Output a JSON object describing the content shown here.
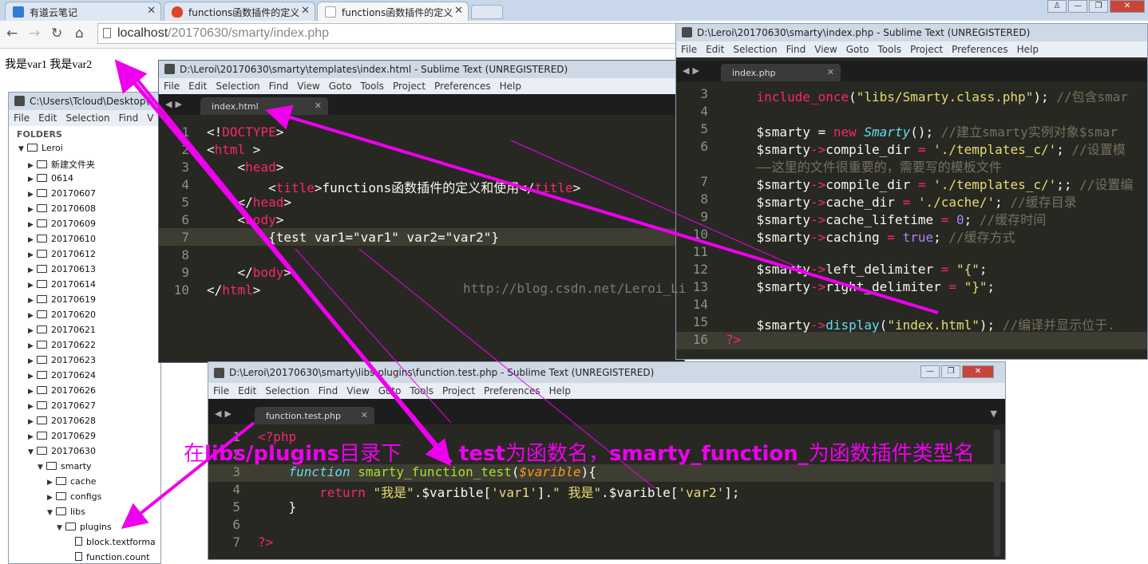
{
  "browser": {
    "tabs": [
      {
        "label": "有道云笔记",
        "icon_color": "#2f7bd8"
      },
      {
        "label": "functions函数插件的定义",
        "icon_color": "#e0442a"
      },
      {
        "label": "functions函数插件的定义",
        "icon_color": "#9aa7b8"
      }
    ],
    "url_host": "localhost",
    "url_path": "/20170630/smarty/index.php",
    "page_output": "我是var1 我是var2"
  },
  "menu_items": [
    "File",
    "Edit",
    "Selection",
    "Find",
    "View",
    "Goto",
    "Tools",
    "Project",
    "Preferences",
    "Help"
  ],
  "folders_window": {
    "title": "C:\\Users\\Tcloud\\Desktop\\2",
    "menu": [
      "File",
      "Edit",
      "Selection",
      "Find",
      "V"
    ],
    "header": "FOLDERS",
    "tree": [
      {
        "label": "Leroi",
        "depth": 0,
        "type": "open"
      },
      {
        "label": "新建文件夹",
        "depth": 1,
        "type": "closed"
      },
      {
        "label": "0614",
        "depth": 1,
        "type": "closed"
      },
      {
        "label": "20170607",
        "depth": 1,
        "type": "closed"
      },
      {
        "label": "20170608",
        "depth": 1,
        "type": "closed"
      },
      {
        "label": "20170609",
        "depth": 1,
        "type": "closed"
      },
      {
        "label": "20170610",
        "depth": 1,
        "type": "closed"
      },
      {
        "label": "20170612",
        "depth": 1,
        "type": "closed"
      },
      {
        "label": "20170613",
        "depth": 1,
        "type": "closed"
      },
      {
        "label": "20170614",
        "depth": 1,
        "type": "closed"
      },
      {
        "label": "20170619",
        "depth": 1,
        "type": "closed"
      },
      {
        "label": "20170620",
        "depth": 1,
        "type": "closed"
      },
      {
        "label": "20170621",
        "depth": 1,
        "type": "closed"
      },
      {
        "label": "20170622",
        "depth": 1,
        "type": "closed"
      },
      {
        "label": "20170623",
        "depth": 1,
        "type": "closed"
      },
      {
        "label": "20170624",
        "depth": 1,
        "type": "closed"
      },
      {
        "label": "20170626",
        "depth": 1,
        "type": "closed"
      },
      {
        "label": "20170627",
        "depth": 1,
        "type": "closed"
      },
      {
        "label": "20170628",
        "depth": 1,
        "type": "closed"
      },
      {
        "label": "20170629",
        "depth": 1,
        "type": "closed"
      },
      {
        "label": "20170630",
        "depth": 1,
        "type": "open"
      },
      {
        "label": "smarty",
        "depth": 2,
        "type": "open"
      },
      {
        "label": "cache",
        "depth": 3,
        "type": "closed"
      },
      {
        "label": "configs",
        "depth": 3,
        "type": "closed"
      },
      {
        "label": "libs",
        "depth": 3,
        "type": "open"
      },
      {
        "label": "plugins",
        "depth": 4,
        "type": "open"
      },
      {
        "label": "block.textforma",
        "depth": 5,
        "type": "file"
      },
      {
        "label": "function.count",
        "depth": 5,
        "type": "file"
      }
    ]
  },
  "index_html_window": {
    "title": "D:\\Leroi\\20170630\\smarty\\templates\\index.html - Sublime Text (UNREGISTERED)",
    "tab": "index.html",
    "line_numbers": [
      "1",
      "2",
      "3",
      "4",
      "5",
      "6",
      "7",
      "8",
      "9",
      "10"
    ],
    "title_text": "functions函数插件的定义和使用",
    "test_call": "{test var1=\"var1\" var2=\"var2\"}"
  },
  "index_php_window": {
    "title": "D:\\Leroi\\20170630\\smarty\\index.php - Sublime Text (UNREGISTERED)",
    "tab": "index.php",
    "line_numbers": [
      "3",
      "4",
      "5",
      "6",
      "",
      "7",
      "8",
      "9",
      "10",
      "11",
      "12",
      "13",
      "14",
      "15",
      "16"
    ],
    "comments": {
      "l3": "//包含smar",
      "l5": "//建立smarty实例对象$smar",
      "l6": "//设置模",
      "l6b": "——这里的文件很重要的，需要写的模板文件",
      "l7": "//设置编",
      "l8": "//缓存目录",
      "l9": "//缓存时间",
      "l10": "//缓存方式",
      "l15": "//编译并显示位于."
    }
  },
  "function_test_window": {
    "title": "D:\\Leroi\\20170630\\smarty\\libs\\plugins\\function.test.php - Sublime Text (UNREGISTERED)",
    "tab": "function.test.php",
    "line_numbers": [
      "1",
      "2",
      "3",
      "4",
      "5",
      "6",
      "7"
    ]
  },
  "annotations": {
    "plugins_dir_prefix": "在",
    "plugins_dir_path": "libs/plugins",
    "plugins_dir_suffix": "目录下",
    "func_name_1": "test",
    "func_name_2": "为函数名，",
    "func_name_3": "smarty_function_",
    "func_name_4": "为函数插件类型名"
  },
  "watermark": "http://blog.csdn.net/Leroi_Li",
  "accent_color": "#ee00ee"
}
